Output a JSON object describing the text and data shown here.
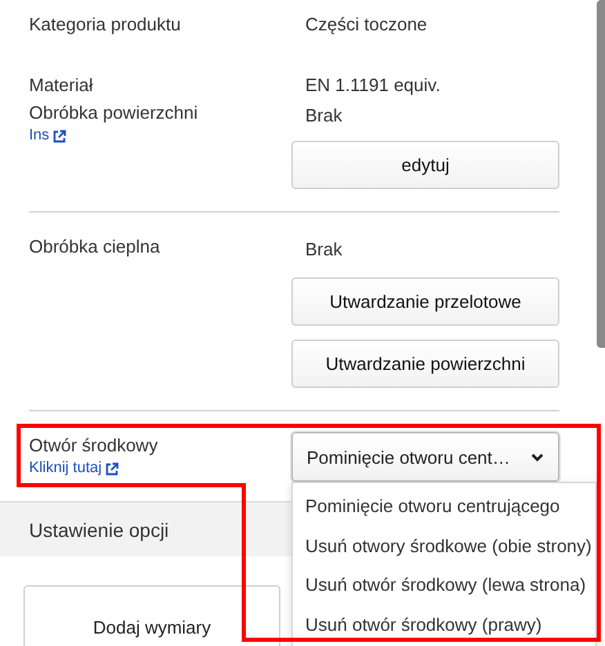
{
  "sections": [
    {
      "rows": [
        {
          "label": "Kategoria produktu",
          "value": "Części toczone"
        },
        {
          "label": "Materiał",
          "value": "EN 1.1191 equiv."
        },
        {
          "label": "Obróbka powierzchni",
          "link": "Ins",
          "value": "Brak"
        }
      ],
      "buttons": [
        "edytuj"
      ]
    },
    {
      "rows": [
        {
          "label": "Obróbka cieplna",
          "value": "Brak"
        }
      ],
      "buttons": [
        "Utwardzanie przelotowe",
        "Utwardzanie powierzchni"
      ]
    }
  ],
  "center_hole": {
    "label": "Otwór środkowy",
    "link": "Kliknij tutaj",
    "select": {
      "value": "Pominięcie otworu cent…",
      "expanded": true,
      "options": [
        "Pominięcie otworu centrującego",
        "Usuń otwory środkowe (obie strony)",
        "Usuń otwór środkowy (lewa strona)",
        "Usuń otwór środkowy (prawy)"
      ]
    }
  },
  "option_settings": {
    "title": "Ustawienie opcji",
    "buttons": [
      "Dodaj wymiary"
    ]
  }
}
